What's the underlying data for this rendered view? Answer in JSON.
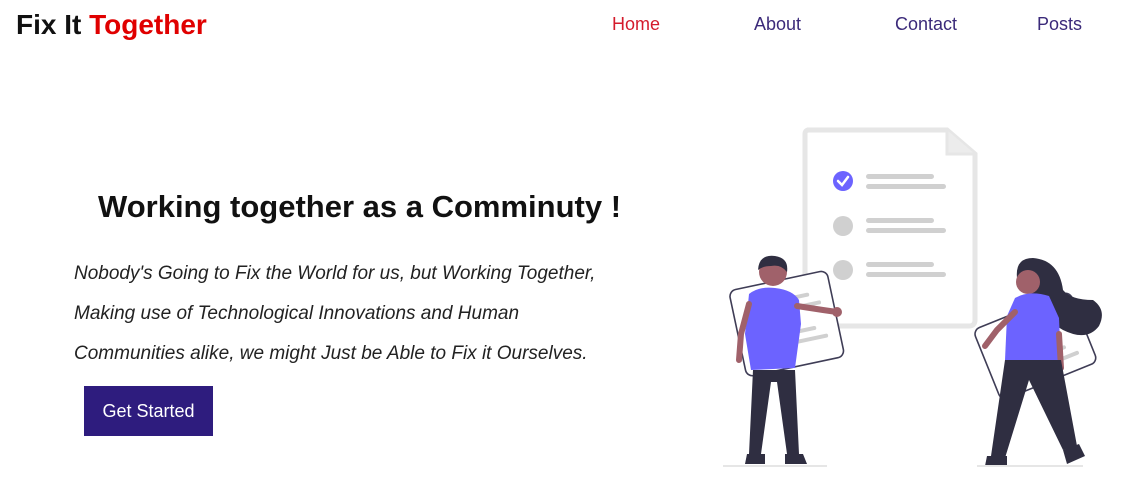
{
  "brand": {
    "part1": "Fix It ",
    "part2": "Together"
  },
  "nav": {
    "home": "Home",
    "about": "About",
    "contact": "Contact",
    "posts": "Posts"
  },
  "hero": {
    "title": "Working together as a Comminuty !",
    "lines": [
      "Nobody's Going to Fix the World for us, but Working Together,",
      "Making use of Technological Innovations and Human",
      "Communities alike, we might Just be Able to Fix it Ourselves."
    ],
    "cta": "Get Started"
  },
  "colors": {
    "brand_red": "#e00000",
    "nav_active": "#d41b2c",
    "nav_normal": "#3b2a7a",
    "button": "#2e1c7e",
    "illustration_accent": "#6c63ff"
  },
  "icons": {
    "illustration": "team-checklist-illustration",
    "check": "check-icon"
  }
}
